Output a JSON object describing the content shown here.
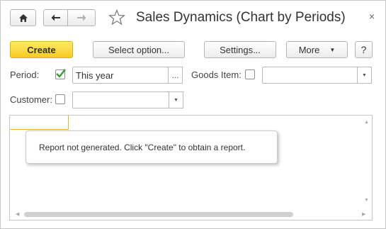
{
  "window": {
    "title": "Sales Dynamics (Chart by Periods)",
    "close_glyph": "×"
  },
  "nav": {
    "home_icon": "home-icon",
    "back_icon": "arrow-left-icon",
    "forward_icon": "arrow-right-icon",
    "favorite_icon": "star-icon"
  },
  "toolbar": {
    "create_label": "Create",
    "select_option_label": "Select option...",
    "settings_label": "Settings...",
    "more_label": "More",
    "help_label": "?"
  },
  "filters": {
    "period_label": "Period:",
    "period_checked": true,
    "period_value": "This year",
    "period_choice_glyph": "...",
    "goods_item_label": "Goods Item:",
    "goods_item_checked": false,
    "goods_item_value": "",
    "customer_label": "Customer:",
    "customer_checked": false,
    "customer_value": ""
  },
  "report": {
    "message": "Report not generated. Click \"Create\" to obtain a report."
  },
  "colors": {
    "create_button": "#f5cc21",
    "check_mark": "#3a9a3a",
    "selected_cell_border": "#e3b72a"
  }
}
